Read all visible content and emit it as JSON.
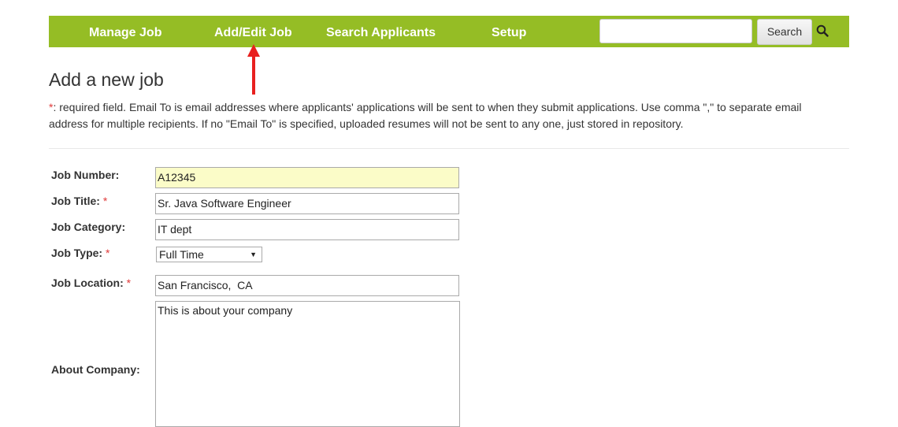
{
  "nav": {
    "items": [
      {
        "label": "Manage Job"
      },
      {
        "label": "Add/Edit Job"
      },
      {
        "label": "Search Applicants"
      },
      {
        "label": "Setup"
      }
    ],
    "search": {
      "value": "",
      "button_label": "Search",
      "icon": "search-icon"
    },
    "bar_color": "#95bd25"
  },
  "annotation": {
    "arrow_color": "#e8201f",
    "points_to": "Add/Edit Job"
  },
  "page": {
    "title": "Add a new job",
    "required_marker": "*",
    "intro_text": ": required field. Email To is email addresses where applicants' applications will be sent to when they submit applications. Use comma \",\" to separate email address for multiple recipients. If no \"Email To\" is specified, uploaded resumes will not be sent to any one, just stored in repository."
  },
  "form": {
    "job_number": {
      "label": "Job Number:",
      "value": "A12345"
    },
    "job_title": {
      "label": "Job Title:",
      "value": "Sr. Java Software Engineer"
    },
    "job_category": {
      "label": "Job Category:",
      "value": "IT dept"
    },
    "job_type": {
      "label": "Job Type:",
      "value": "Full Time"
    },
    "job_location": {
      "label": "Job Location:",
      "value": "San Francisco,  CA"
    },
    "about_company": {
      "label": "About Company:",
      "value": "This is about your company"
    }
  }
}
